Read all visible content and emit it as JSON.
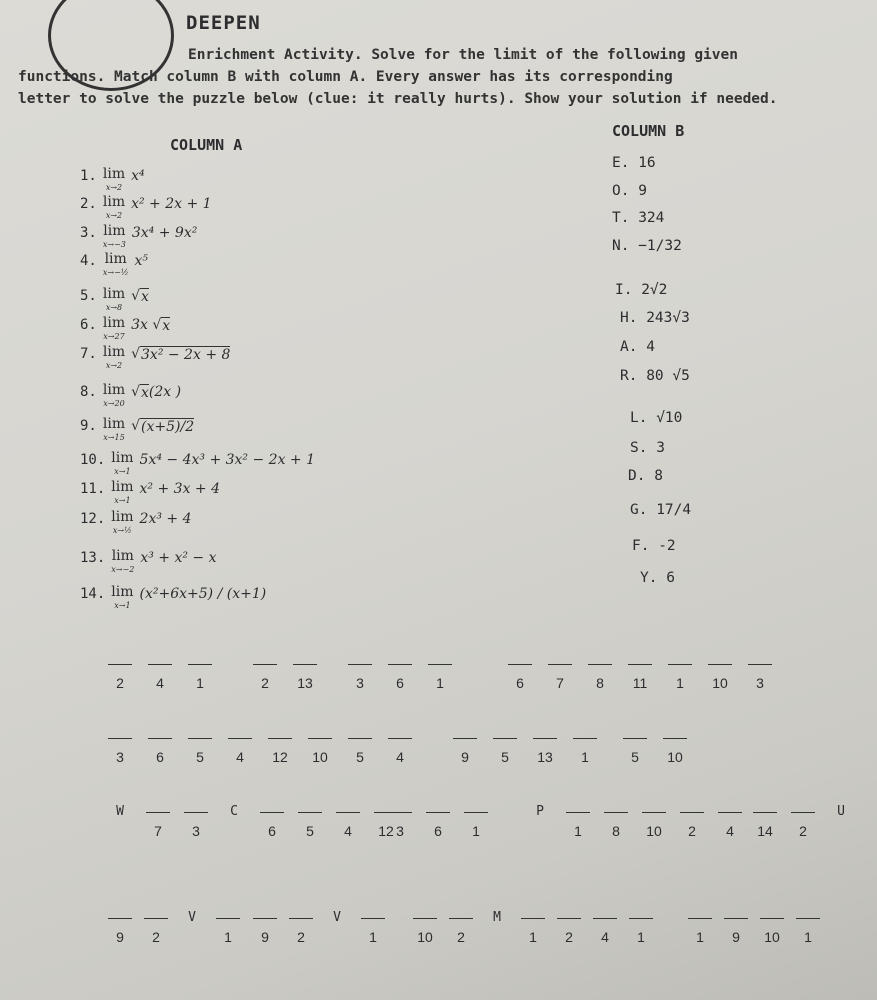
{
  "header": {
    "title": "DEEPEN",
    "logo": "deepen-logo"
  },
  "instructions": {
    "line1": "Enrichment Activity.  Solve for the limit of the following given",
    "line2": "functions. Match column B with column A. Every answer has its corresponding",
    "line3": "letter to solve the puzzle below (clue: it really hurts). Show your solution if needed."
  },
  "column_a": {
    "heading": "COLUMN A",
    "items": [
      {
        "num": "1.",
        "lim": "lim",
        "sub": "x→2",
        "expr": "x⁴"
      },
      {
        "num": "2.",
        "lim": "lim",
        "sub": "x→2",
        "expr": "x² + 2x + 1"
      },
      {
        "num": "3.",
        "lim": "lim",
        "sub": "x→−3",
        "expr": "3x⁴ + 9x²"
      },
      {
        "num": "4.",
        "lim": "lim",
        "sub": "x→−½",
        "expr": "x⁵"
      },
      {
        "num": "5.",
        "lim": "lim",
        "sub": "x→8",
        "expr": "√",
        "rad": "x"
      },
      {
        "num": "6.",
        "lim": "lim",
        "sub": "x→27",
        "expr": "3x √",
        "rad": "x"
      },
      {
        "num": "7.",
        "lim": "lim",
        "sub": "x→2",
        "expr": "√",
        "rad": "3x² − 2x + 8"
      },
      {
        "num": "8.",
        "lim": "lim",
        "sub": "x→20",
        "expr": "√",
        "rad": "x",
        "after": " (2x )"
      },
      {
        "num": "9.",
        "lim": "lim",
        "sub": "x→15",
        "expr": "√",
        "rad": "(x+5)/2"
      },
      {
        "num": "10.",
        "lim": "lim",
        "sub": "x→1",
        "expr": "5x⁴ − 4x³ + 3x² − 2x + 1"
      },
      {
        "num": "11.",
        "lim": "lim",
        "sub": "x→1",
        "expr": "x² + 3x + 4"
      },
      {
        "num": "12.",
        "lim": "lim",
        "sub": "x→½",
        "expr": "2x³ + 4"
      },
      {
        "num": "13.",
        "lim": "lim",
        "sub": "x→−2",
        "expr": "x³ + x² − x"
      },
      {
        "num": "14.",
        "lim": "lim",
        "sub": "x→1",
        "expr": "(x²+6x+5) / (x+1)"
      }
    ]
  },
  "column_b": {
    "heading": "COLUMN B",
    "items": [
      "E. 16",
      "O. 9",
      "T. 324",
      "N. −1/32",
      "I. 2√2",
      "H.  243√3",
      "A. 4",
      "R. 80 √5",
      "L. √10",
      "S. 3",
      "D. 8",
      "G.  17/4",
      "F. -2",
      "Y. 6"
    ]
  },
  "puzzle": {
    "rows": [
      [
        [
          "2",
          "4",
          "1"
        ],
        [
          "2",
          "13"
        ],
        [
          "3",
          "6",
          "1"
        ],
        [
          "6",
          "7",
          "8",
          "11",
          "1",
          "10",
          "3"
        ]
      ],
      [
        [
          "3",
          "6",
          "5",
          "4",
          "12",
          "10"
        ],
        [
          "5",
          "4"
        ],
        [
          "9",
          "5",
          "13",
          "1"
        ],
        [
          "5",
          "10"
        ]
      ],
      [
        [
          "W",
          "7",
          "3",
          "C",
          "6",
          "5",
          "4",
          "12"
        ],
        [
          "3",
          "6",
          "1"
        ],
        [
          "P",
          "1",
          "8",
          "10",
          "2",
          "4"
        ],
        [
          "14",
          "2",
          "U"
        ]
      ],
      [
        [
          "9",
          "2",
          "V",
          "1"
        ],
        [
          "9",
          "2",
          "V",
          "1"
        ],
        [
          "10",
          "2",
          "M",
          "1",
          "2",
          "4",
          "1"
        ],
        [
          "1",
          "9",
          "10",
          "1"
        ]
      ]
    ]
  }
}
